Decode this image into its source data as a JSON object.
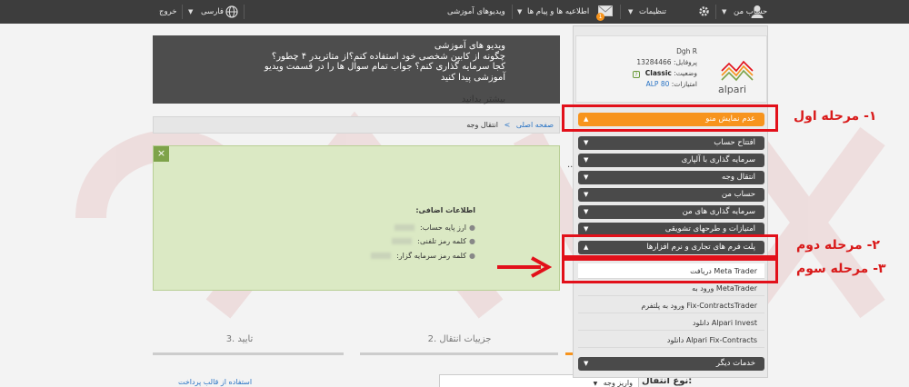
{
  "topbar": {
    "logout": "خروج",
    "language": "فارسی",
    "tutorials": "ویدیوهای آموزشی",
    "notifications": "اطلاعیه ها و پیام ها",
    "settings": "تنظیمات",
    "my_account": "حساب من",
    "badge": "1"
  },
  "video_box": {
    "line1": "ویدیو های آموزشی",
    "line2": "چگونه از کابین شخصی خود استفاده کنم؟از متاتریدر ۴ چطور؟",
    "line3": "کجا سرمایه گذاری کنم؟ جواب تمام سوال ها را در قسمت ویدیو",
    "line4": "آموزشی پیدا کنید",
    "more": "بیشتر بدانید"
  },
  "breadcrumb": {
    "home": "صفحه اصلی",
    "sep": ">",
    "current": "انتقال وجه"
  },
  "green_panel": {
    "close": "×",
    "dot": "..",
    "info_title": "اطلاعات اضافی:",
    "rows": [
      "ارز پایه حساب:",
      "کلمه رمز تلفنی:",
      "کلمه رمز سرمایه گزار:"
    ]
  },
  "account": {
    "name": "Dgh R",
    "profile_label": "پروفایل:",
    "profile_value": "13284466",
    "status_label": "وضعیت:",
    "status_value": "Classic",
    "points_label": "امتیازات:",
    "points_value": "ALP 80",
    "logo_text": "alpari"
  },
  "sidebar": {
    "hide_menu": "عدم نمایش منو",
    "menu": [
      "افتتاح حساب",
      "سرمایه گذاری با آلپاری",
      "انتقال وجه",
      "حساب من",
      "سرمایه گذاری های من",
      "امتیازات و طرحهای تشویقی",
      "پلت فرم های تجاری و نرم افزارها"
    ],
    "submenu": [
      "دریافت Meta Trader",
      "ورود به MetaTrader",
      "ورود به پلتفرم Fix-ContractsTrader",
      "دانلود Alpari Invest",
      "دانلود Alpari Fix-Contracts"
    ],
    "other_services": "خدمات دیگر"
  },
  "steps": {
    "step2": "2. جزییات انتقال",
    "step3": "3. تایید"
  },
  "form": {
    "pay_link": "استفاده از قالب پرداخت",
    "transfer_type_label": "نوع انتقال:",
    "transfer_type_value": "واریز وجه"
  },
  "annotations": {
    "step1": "۱- مرحله اول",
    "step2": "۲- مرحله دوم",
    "step3": "۳- مرحله سوم"
  },
  "colors": {
    "topbar": "#3d3d3d",
    "accent_orange": "#f7941d",
    "annotation_red": "#e2101a",
    "panel_green": "#dbe9c4",
    "link_blue": "#2a74c5"
  }
}
